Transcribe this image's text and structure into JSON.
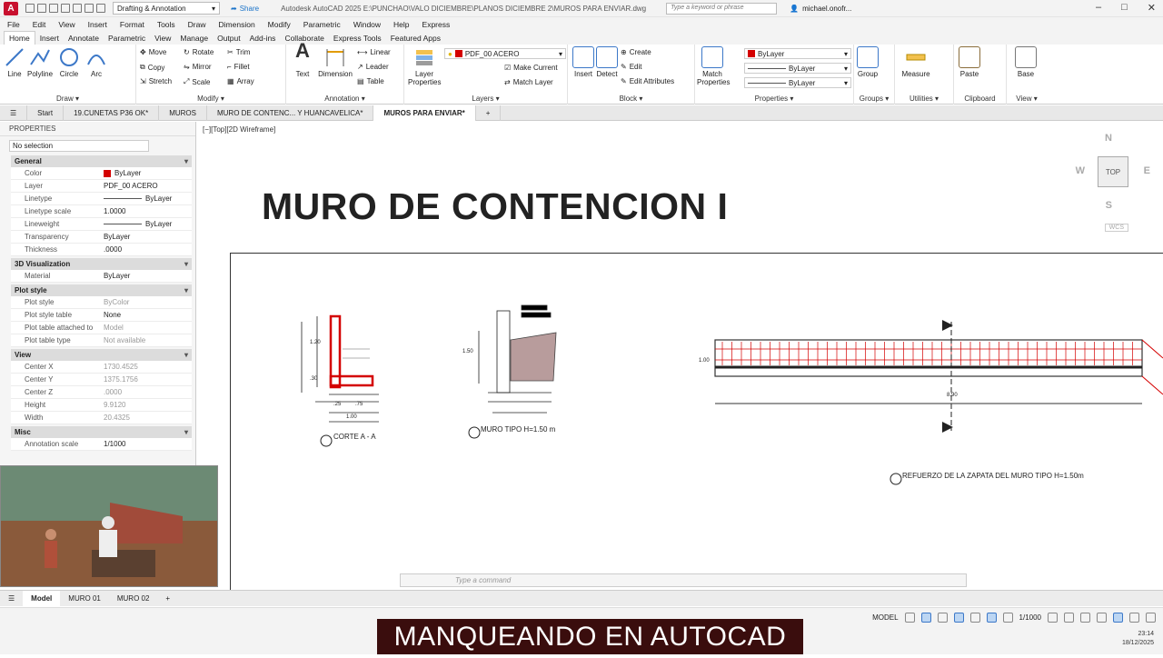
{
  "titlebar": {
    "app_logo": "A",
    "workspace": "Drafting & Annotation",
    "share": "Share",
    "title": "Autodesk AutoCAD 2025   E:\\PUNCHAO\\VALO DICIEMBRE\\PLANOS DICIEMBRE 2\\MUROS PARA ENVIAR.dwg",
    "search_placeholder": "Type a keyword or phrase",
    "user": "michael.onofr...",
    "win_min": "–",
    "win_max": "□",
    "win_close": "✕"
  },
  "menu": [
    "File",
    "Edit",
    "View",
    "Insert",
    "Format",
    "Tools",
    "Draw",
    "Dimension",
    "Modify",
    "Parametric",
    "Window",
    "Help",
    "Express"
  ],
  "ribbon_tabs": [
    "Home",
    "Insert",
    "Annotate",
    "Parametric",
    "View",
    "Manage",
    "Output",
    "Add-ins",
    "Collaborate",
    "Express Tools",
    "Featured Apps"
  ],
  "ribbon": {
    "draw": {
      "title": "Draw ▾",
      "line": "Line",
      "polyline": "Polyline",
      "circle": "Circle",
      "arc": "Arc"
    },
    "modify": {
      "title": "Modify ▾",
      "move": "Move",
      "rotate": "Rotate",
      "trim": "Trim",
      "copy": "Copy",
      "mirror": "Mirror",
      "fillet": "Fillet",
      "stretch": "Stretch",
      "scale": "Scale",
      "array": "Array"
    },
    "annotation": {
      "title": "Annotation ▾",
      "text": "Text",
      "dimension": "Dimension",
      "linear": "Linear",
      "leader": "Leader",
      "table": "Table"
    },
    "layers": {
      "title": "Layers ▾",
      "layer_properties": "Layer Properties",
      "current_layer": "PDF_00 ACERO",
      "make_current": "Make Current",
      "match_layer": "Match Layer"
    },
    "block": {
      "title": "Block ▾",
      "insert": "Insert",
      "detect": "Detect",
      "create": "Create",
      "edit": "Edit",
      "edit_attributes": "Edit Attributes"
    },
    "properties": {
      "title": "Properties ▾",
      "match": "Match Properties",
      "color": "ByLayer",
      "linetype": "ByLayer",
      "lineweight": "ByLayer"
    },
    "groups": {
      "title": "Groups ▾",
      "group": "Group"
    },
    "utilities": {
      "title": "Utilities ▾",
      "measure": "Measure"
    },
    "clipboard": {
      "title": "Clipboard",
      "paste": "Paste"
    },
    "view": {
      "title": "View ▾",
      "base": "Base"
    }
  },
  "doc_tabs": [
    "Start",
    "19.CUNETAS P36 OK*",
    "MUROS",
    "MURO DE CONTENC... Y HUANCAVELICA*",
    "MUROS PARA ENVIAR*"
  ],
  "properties_panel": {
    "header": "PROPERTIES",
    "selection": "No selection",
    "general": {
      "title": "General",
      "rows": [
        {
          "k": "Color",
          "v": "ByLayer"
        },
        {
          "k": "Layer",
          "v": "PDF_00 ACERO"
        },
        {
          "k": "Linetype",
          "v": "ByLayer"
        },
        {
          "k": "Linetype scale",
          "v": "1.0000"
        },
        {
          "k": "Lineweight",
          "v": "ByLayer"
        },
        {
          "k": "Transparency",
          "v": "ByLayer"
        },
        {
          "k": "Thickness",
          "v": ".0000"
        }
      ]
    },
    "viz": {
      "title": "3D Visualization",
      "rows": [
        {
          "k": "Material",
          "v": "ByLayer"
        }
      ]
    },
    "plot": {
      "title": "Plot style",
      "rows": [
        {
          "k": "Plot style",
          "v": "ByColor"
        },
        {
          "k": "Plot style table",
          "v": "None"
        },
        {
          "k": "Plot table attached to",
          "v": "Model"
        },
        {
          "k": "Plot table type",
          "v": "Not available"
        }
      ]
    },
    "view": {
      "title": "View",
      "rows": [
        {
          "k": "Center X",
          "v": "1730.4525"
        },
        {
          "k": "Center Y",
          "v": "1375.1756"
        },
        {
          "k": "Center Z",
          "v": ".0000"
        },
        {
          "k": "Height",
          "v": "9.9120"
        },
        {
          "k": "Width",
          "v": "20.4325"
        }
      ]
    },
    "misc": {
      "title": "Misc",
      "rows": [
        {
          "k": "Annotation scale",
          "v": "1/1000"
        }
      ]
    }
  },
  "canvas": {
    "viewport_label": "[−][Top][2D Wireframe]",
    "drawing_title": "MURO DE CONTENCION I",
    "viewcube": {
      "top": "TOP",
      "n": "N",
      "s": "S",
      "e": "E",
      "w": "W",
      "wcs": "WCS"
    },
    "details": {
      "corte": "CORTE A - A",
      "muro_tipo": "MURO TIPO H=1.50 m",
      "refuerzo": "REFUERZO DE LA ZAPATA DEL MURO TIPO H=1.50m",
      "dim_100": "1.00",
      "dim_75": ".75",
      "dim_25": ".25",
      "dim_890": "8.90",
      "dim_150": "1.50",
      "dim_120": "1.20",
      "dim_30": ".30",
      "dim_100v": "1.00"
    }
  },
  "command_placeholder": "Type a command",
  "layout_tabs": [
    "Model",
    "MURO 01",
    "MURO 02"
  ],
  "statusbar": {
    "model": "MODEL",
    "scale": "1/1000"
  },
  "banner": "MANQUEANDO EN AUTOCAD",
  "clock": {
    "time": "23:14",
    "date": "18/12/2025"
  }
}
